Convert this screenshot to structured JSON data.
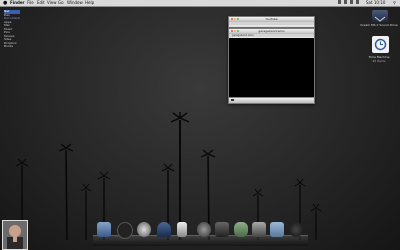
{
  "menubar": {
    "apple": "",
    "app": "Finder",
    "items": [
      "File",
      "Edit",
      "View",
      "Go",
      "Window",
      "Help"
    ],
    "clock": "Sat 10:10"
  },
  "sidebar": {
    "items": [
      "Net",
      "Des",
      "Documents",
      "Apps",
      "Mac",
      "Music",
      "Pics",
      "Movies",
      "Sites",
      "Dropbox",
      "Books"
    ]
  },
  "player_mini": {
    "title": "YouTube"
  },
  "player_main": {
    "title": "garageband.wmv",
    "info": "garageband.wmv"
  },
  "desktop": {
    "drive_label": "Cream MS 2 Sound Drive",
    "tm_label": "Time Machine",
    "tm_sub": "45 Items"
  },
  "colors": {
    "accent": "#3a5fb0",
    "background": "#262626",
    "menubar": "#d9d9d9"
  },
  "dock": {
    "icons": [
      "finder-icon",
      "camera-icon",
      "clock-icon",
      "launchpad-icon",
      "ipod-icon",
      "disk-utility-icon",
      "photobooth-icon",
      "alien-icon",
      "time-machine-icon",
      "downloads-icon",
      "trash-icon",
      "record-icon"
    ]
  }
}
